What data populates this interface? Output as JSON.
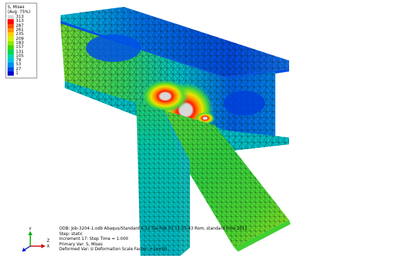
{
  "legend": {
    "title_line1": "S, Mises",
    "title_line2": "(Avg: 75%)",
    "entries": [
      {
        "label": "313",
        "color": "#d8d8d8"
      },
      {
        "label": "313",
        "color": "#ff0000"
      },
      {
        "label": "287",
        "color": "#ff4a00"
      },
      {
        "label": "261",
        "color": "#ff9200"
      },
      {
        "label": "235",
        "color": "#ffcf00"
      },
      {
        "label": "209",
        "color": "#d6f000"
      },
      {
        "label": "183",
        "color": "#8fe800"
      },
      {
        "label": "157",
        "color": "#3fd800"
      },
      {
        "label": "131",
        "color": "#00d850"
      },
      {
        "label": "105",
        "color": "#00d8a6"
      },
      {
        "label": "79",
        "color": "#00c4e0"
      },
      {
        "label": "53",
        "color": "#008cf0"
      },
      {
        "label": "27",
        "color": "#0048e8"
      },
      {
        "label": "1",
        "color": "#0000c8"
      }
    ]
  },
  "info": {
    "odb_line": "ODB: Job-3204-1.odb    Abaqus/Standard 6.1x    Tue Feb 01 11:55:43 Rom, standard time 2011",
    "step_line": "Step: static",
    "increment_line": "Increment    17: Step Time =    1.000",
    "primary_var_line": "Primary Var: S, Mises",
    "deformed_var_line": "Deformed Var: U   Deformation Scale Factor: +1e+00"
  },
  "triad": {
    "x_label": "X",
    "y_label": "Y",
    "z_label": "Z"
  },
  "colors": {
    "mesh": "#0a1a10",
    "blue": "#0040e0",
    "cyan": "#00b8d8",
    "teal": "#00c8a0",
    "green": "#30d030",
    "yellow": "#e8e000",
    "orange": "#ff9000",
    "red": "#ff2000",
    "gray": "#d8d8d8"
  }
}
